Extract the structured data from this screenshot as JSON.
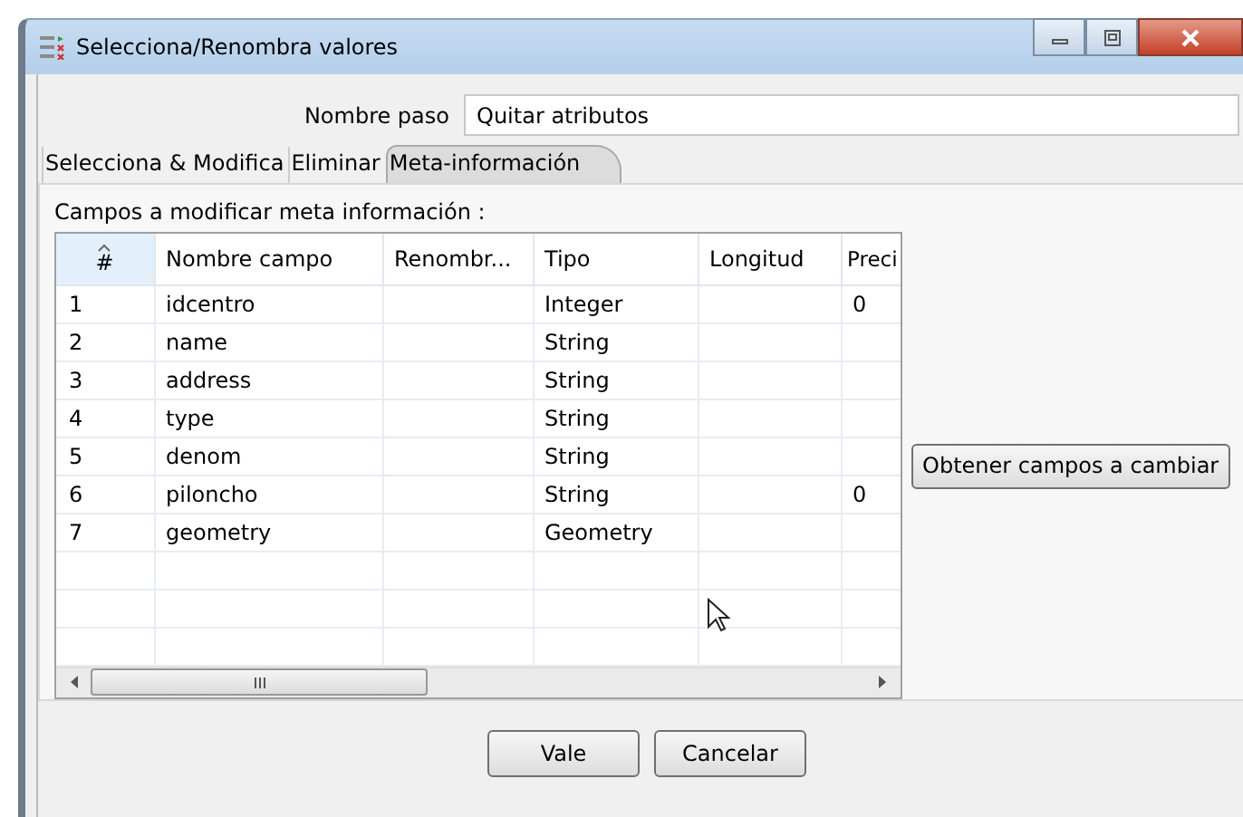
{
  "window": {
    "title": "Selecciona/Renombra valores"
  },
  "step_name": {
    "label": "Nombre paso",
    "value": "Quitar atributos"
  },
  "tabs": [
    {
      "label": "Selecciona & Modifica",
      "selected": false
    },
    {
      "label": "Eliminar",
      "selected": false
    },
    {
      "label": "Meta-información",
      "selected": true
    }
  ],
  "table": {
    "label": "Campos a modificar meta información :",
    "columns": [
      {
        "label": "#",
        "sorted": true
      },
      {
        "label": "Nombre campo",
        "sorted": false
      },
      {
        "label": "Renombr...",
        "sorted": false
      },
      {
        "label": "Tipo",
        "sorted": false
      },
      {
        "label": "Longitud",
        "sorted": false
      },
      {
        "label": "Preci",
        "sorted": false
      }
    ],
    "rows": [
      [
        "1",
        "idcentro",
        "",
        "Integer",
        "",
        "0"
      ],
      [
        "2",
        "name",
        "",
        "String",
        "",
        ""
      ],
      [
        "3",
        "address",
        "",
        "String",
        "",
        ""
      ],
      [
        "4",
        "type",
        "",
        "String",
        "",
        ""
      ],
      [
        "5",
        "denom",
        "",
        "String",
        "",
        ""
      ],
      [
        "6",
        "piloncho",
        "",
        "String",
        "",
        "0"
      ],
      [
        "7",
        "geometry",
        "",
        "Geometry",
        "",
        ""
      ]
    ]
  },
  "get_fields_button": "Obtener campos a cambiar",
  "buttons": [
    "Vale",
    "Cancelar"
  ]
}
